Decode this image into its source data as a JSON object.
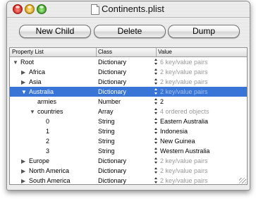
{
  "window": {
    "title": "Continents.plist"
  },
  "toolbar": {
    "new_child_label": "New Child",
    "delete_label": "Delete",
    "dump_label": "Dump"
  },
  "columns": {
    "property": "Property List",
    "class": "Class",
    "value": "Value"
  },
  "rows": [
    {
      "name": "Root",
      "class": "Dictionary",
      "value": "6 key/value pairs",
      "expander": "open",
      "stepper": true,
      "dim": true
    },
    {
      "name": "Africa",
      "class": "Dictionary",
      "value": "2 key/value pairs",
      "expander": "closed",
      "stepper": true,
      "dim": true
    },
    {
      "name": "Asia",
      "class": "Dictionary",
      "value": "2 key/value pairs",
      "expander": "closed",
      "stepper": true,
      "dim": true
    },
    {
      "name": "Australia",
      "class": "Dictionary",
      "value": "2 key/value pairs",
      "expander": "open",
      "stepper": true,
      "dim": true,
      "selected": true
    },
    {
      "name": "armies",
      "class": "Number",
      "value": "2",
      "expander": "none",
      "stepper": true,
      "dim": false
    },
    {
      "name": "countries",
      "class": "Array",
      "value": "4 ordered objects",
      "expander": "open",
      "stepper": true,
      "dim": true
    },
    {
      "name": "0",
      "class": "String",
      "value": "Eastern Australia",
      "expander": "none",
      "stepper": true,
      "dim": false
    },
    {
      "name": "1",
      "class": "String",
      "value": "Indonesia",
      "expander": "none",
      "stepper": true,
      "dim": false
    },
    {
      "name": "2",
      "class": "String",
      "value": "New Guinea",
      "expander": "none",
      "stepper": true,
      "dim": false
    },
    {
      "name": "3",
      "class": "String",
      "value": "Western Australia",
      "expander": "none",
      "stepper": true,
      "dim": false
    },
    {
      "name": "Europe",
      "class": "Dictionary",
      "value": "2 key/value pairs",
      "expander": "closed",
      "stepper": true,
      "dim": true
    },
    {
      "name": "North America",
      "class": "Dictionary",
      "value": "2 key/value pairs",
      "expander": "closed",
      "stepper": true,
      "dim": true
    },
    {
      "name": "South America",
      "class": "Dictionary",
      "value": "2 key/value pairs",
      "expander": "closed",
      "stepper": true,
      "dim": true
    }
  ],
  "colors": {
    "selection": "#3875d7",
    "close": "#d8251c",
    "minimize": "#e0a514",
    "zoom": "#3fa321"
  },
  "icons": {
    "document": "document-icon",
    "disclosure_open": "triangle-down-icon",
    "disclosure_closed": "triangle-right-icon",
    "stepper": "up-down-stepper-icon",
    "resize": "resize-grip-icon"
  }
}
